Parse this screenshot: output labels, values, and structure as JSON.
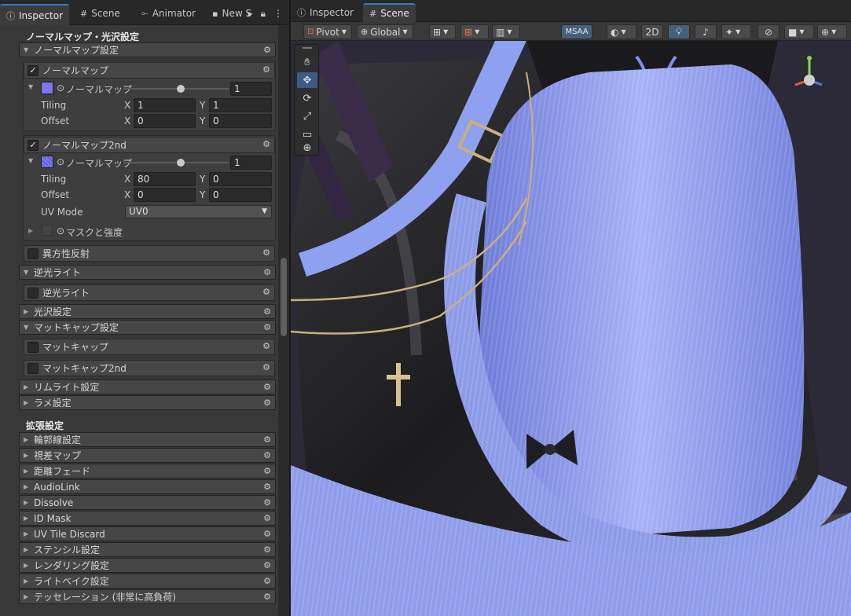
{
  "left_tabs": [
    {
      "label": "Inspector",
      "icon": "info-icon"
    },
    {
      "label": "Scene",
      "icon": "grid-icon"
    },
    {
      "label": "Animator",
      "icon": "animator-icon"
    },
    {
      "label": "New S",
      "icon": "file-icon"
    }
  ],
  "right_tabs": [
    {
      "label": "Inspector",
      "icon": "info-icon"
    },
    {
      "label": "Scene",
      "icon": "grid-icon"
    }
  ],
  "inspector": {
    "section_normal_title": "ノーマルマップ・光沢設定",
    "normalmap_settings": "ノーマルマップ設定",
    "normalmap1": {
      "label": "ノーマルマップ",
      "texture_label": "ノーマルマップ",
      "slider_value": "1",
      "slider_fraction": 0.55,
      "tiling_label": "Tiling",
      "offset_label": "Offset",
      "tiling_x": "1",
      "tiling_y": "1",
      "offset_x": "0",
      "offset_y": "0"
    },
    "normalmap2": {
      "label": "ノーマルマップ2nd",
      "texture_label": "ノーマルマップ",
      "slider_value": "1",
      "slider_fraction": 0.55,
      "tiling_label": "Tiling",
      "offset_label": "Offset",
      "tiling_x": "80",
      "tiling_y": "0",
      "offset_x": "0",
      "offset_y": "0",
      "uvmode_label": "UV Mode",
      "uvmode_value": "UV0",
      "mask_label": "マスクと強度"
    },
    "axis_x": "X",
    "axis_y": "Y",
    "anisotropy": "異方性反射",
    "backlight_fold": "逆光ライト",
    "backlight_toggle": "逆光ライト",
    "gloss": "光沢設定",
    "matcap_settings": "マットキャップ設定",
    "matcap": "マットキャップ",
    "matcap2": "マットキャップ2nd",
    "rimlight": "リムライト設定",
    "glitter": "ラメ設定",
    "section_ext_title": "拡張設定",
    "ext_items": [
      "輪郭線設定",
      "視差マップ",
      "距離フェード",
      "AudioLink",
      "Dissolve",
      "ID Mask",
      "UV Tile Discard",
      "ステンシル設定",
      "レンダリング設定",
      "ライトベイク設定",
      "テッセレーション (非常に高負荷)"
    ]
  },
  "scene_toolbar": {
    "pivot": "Pivot",
    "global": "Global",
    "msaa": "MSAA",
    "mode2d": "2D"
  },
  "colors": {
    "accent": "#3a79bb",
    "texture_swatch": "#7d78f2",
    "apron": "#8f9cf0"
  }
}
